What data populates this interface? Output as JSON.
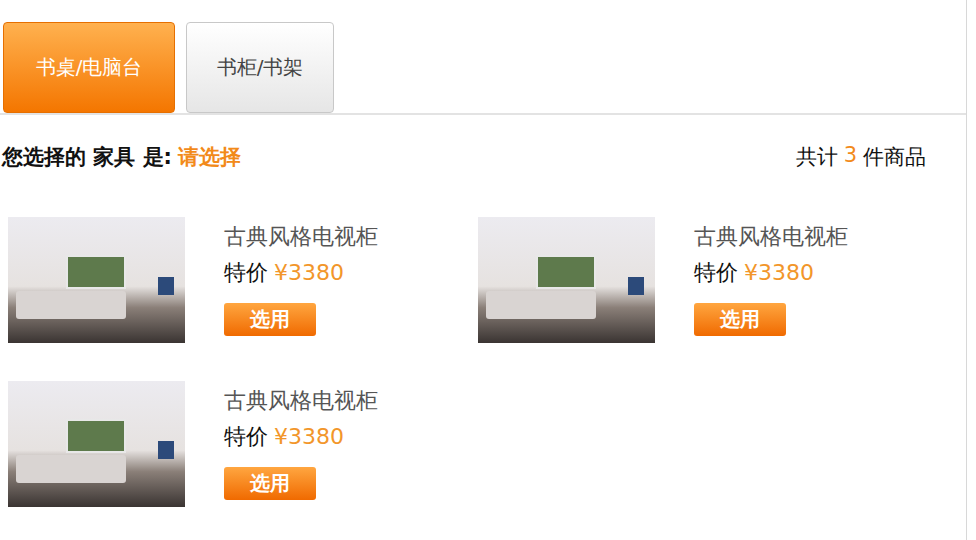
{
  "tabs": [
    {
      "label": "书桌/电脑台",
      "selected": true
    },
    {
      "label": "书柜/书架",
      "selected": false
    }
  ],
  "selection": {
    "prefix": "您选择的 家具 是:",
    "value": "请选择"
  },
  "count": {
    "prefix": "共计",
    "number": "3",
    "suffix": "件商品"
  },
  "products": [
    {
      "name": "古典风格电视柜",
      "price_label": "特价",
      "price": "¥3380",
      "button": "选用"
    },
    {
      "name": "古典风格电视柜",
      "price_label": "特价",
      "price": "¥3380",
      "button": "选用"
    },
    {
      "name": "古典风格电视柜",
      "price_label": "特价",
      "price": "¥3380",
      "button": "选用"
    }
  ]
}
